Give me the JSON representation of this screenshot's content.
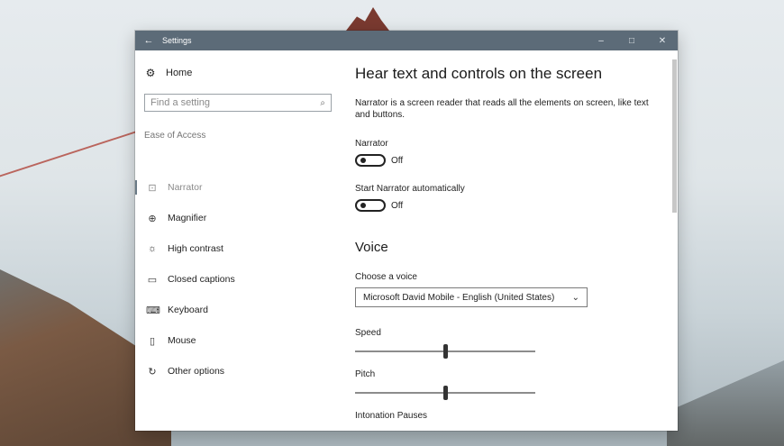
{
  "window": {
    "title": "Settings",
    "back_icon": "←",
    "minimize_icon": "–",
    "maximize_icon": "□",
    "close_icon": "✕"
  },
  "sidebar": {
    "home": {
      "label": "Home",
      "icon": "⚙"
    },
    "search": {
      "placeholder": "Find a setting",
      "icon": "⌕"
    },
    "section": "Ease of Access",
    "items": [
      {
        "label": "Narrator",
        "icon": "⊡",
        "active": true
      },
      {
        "label": "Magnifier",
        "icon": "⊕"
      },
      {
        "label": "High contrast",
        "icon": "☼"
      },
      {
        "label": "Closed captions",
        "icon": "▭"
      },
      {
        "label": "Keyboard",
        "icon": "⌨"
      },
      {
        "label": "Mouse",
        "icon": "▯"
      },
      {
        "label": "Other options",
        "icon": "↻"
      }
    ]
  },
  "main": {
    "title": "Hear text and controls on the screen",
    "description": "Narrator is a screen reader that reads all the elements on screen, like text and buttons.",
    "narrator": {
      "label": "Narrator",
      "state": "Off"
    },
    "autostart": {
      "label": "Start Narrator automatically",
      "state": "Off"
    },
    "voice": {
      "title": "Voice",
      "choose_label": "Choose a voice",
      "selected": "Microsoft David Mobile - English (United States)",
      "chevron": "⌄",
      "speed_label": "Speed",
      "speed_value": 0.5,
      "pitch_label": "Pitch",
      "pitch_value": 0.5,
      "intonation_label": "Intonation Pauses"
    }
  }
}
